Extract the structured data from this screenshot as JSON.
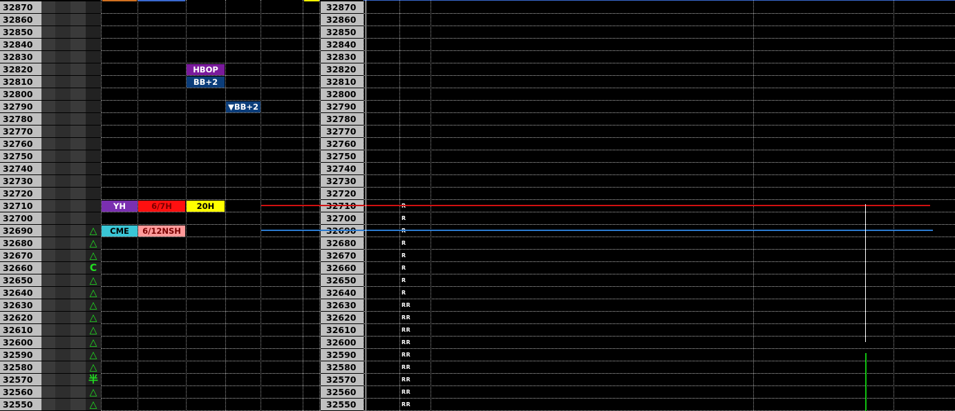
{
  "prices": [
    "32870",
    "32860",
    "32850",
    "32840",
    "32830",
    "32820",
    "32810",
    "32800",
    "32790",
    "32780",
    "32770",
    "32760",
    "32750",
    "32740",
    "32730",
    "32720",
    "32710",
    "32700",
    "32690",
    "32680",
    "32670",
    "32660",
    "32650",
    "32640",
    "32630",
    "32620",
    "32610",
    "32600",
    "32590",
    "32580",
    "32570",
    "32560",
    "32550"
  ],
  "symbols": {
    "32690": "△",
    "32680": "△",
    "32670": "△",
    "32660": "C",
    "32650": "△",
    "32640": "△",
    "32630": "△",
    "32620": "△",
    "32610": "△",
    "32600": "△",
    "32590": "△",
    "32580": "△",
    "32570": "半",
    "32560": "△",
    "32550": "△"
  },
  "tags": [
    {
      "price": "32820",
      "label": "HBOP",
      "column": "col3",
      "color": "#7a1a9c",
      "text_color": "#ffffff"
    },
    {
      "price": "32810",
      "label": "BB+2",
      "column": "col3",
      "color": "#0b3d7a",
      "text_color": "#ffffff"
    },
    {
      "price": "32790",
      "label": "▼BB+2",
      "column": "col4",
      "color": "#0b3d7a",
      "text_color": "#ffffff"
    },
    {
      "price": "32710",
      "label": "YH",
      "column": "col1",
      "color": "#7a2fb0",
      "text_color": "#ffffff"
    },
    {
      "price": "32710",
      "label": "6/7H",
      "column": "col2",
      "color": "#ff1010",
      "text_color": "#7a0000"
    },
    {
      "price": "32710",
      "label": "20H",
      "column": "col3",
      "color": "#ffff00",
      "text_color": "#000000"
    },
    {
      "price": "32690",
      "label": "CME",
      "column": "col1",
      "color": "#3ac6d6",
      "text_color": "#000000"
    },
    {
      "price": "32690",
      "label": "6/12NSH",
      "column": "col2",
      "color": "#ff9a9a",
      "text_color": "#7a0000"
    }
  ],
  "profile_marks": {
    "32710": "R",
    "32700": "R",
    "32690": "R",
    "32680": "R",
    "32670": "R",
    "32660": "R",
    "32650": "R",
    "32640": "R",
    "32630": "RR",
    "32620": "RR",
    "32610": "RR",
    "32600": "RR",
    "32590": "RR",
    "32580": "RR",
    "32570": "RR",
    "32560": "RR",
    "32550": "RR"
  },
  "colors": {
    "red_line": "#d01010",
    "blue_line": "#2a7ad0",
    "green_line": "#10c010",
    "white_line": "#ffffff",
    "top_orange": "#d07020",
    "top_blue": "#3a6ad0",
    "top_yellow": "#ffff00"
  }
}
